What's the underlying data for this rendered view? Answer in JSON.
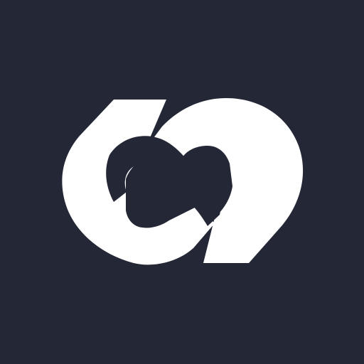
{
  "app_icon": {
    "icon": "interlocking-links-logo-icon",
    "background_color": "#242736",
    "foreground_color": "#FFFFFF"
  }
}
